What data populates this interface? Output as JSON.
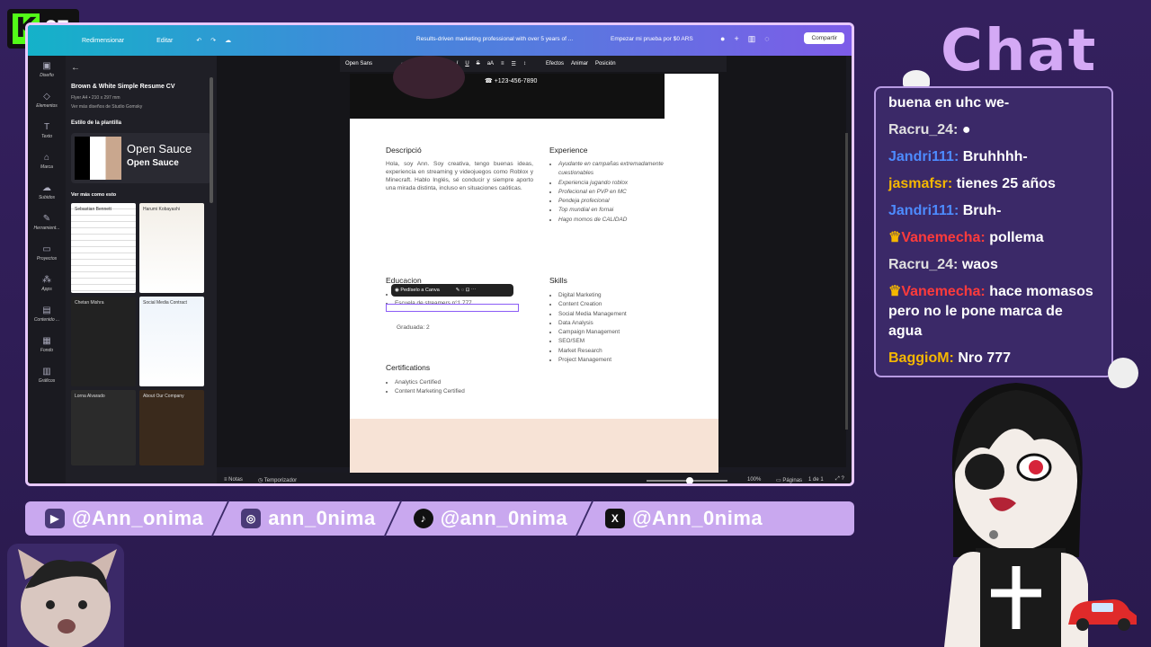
{
  "kick": {
    "logo": "K",
    "viewers": "27"
  },
  "canva": {
    "topbar": {
      "resize": "Redimensionar",
      "edit": "Editar",
      "title": "Results-driven marketing professional with over 5 years of ...",
      "trial": "Empezar mi prueba por $0 ARS",
      "share": "Compartir"
    },
    "rail": [
      "Diseño",
      "Elementos",
      "Texto",
      "Marca",
      "Subidos",
      "Herramient...",
      "Proyectos",
      "Apps",
      "Contenido ...",
      "Fondo",
      "Gráficos"
    ],
    "panel": {
      "template_title": "Brown & White Simple Resume CV",
      "size": "Flyer A4 • 210 x 297 mm",
      "more": "Ver más diseños de Studio Gomsky",
      "style_heading": "Estilo de la plantilla",
      "font_name": "Open Sauce",
      "font_name_bold": "Open Sauce",
      "see_more": "Ver más como esto",
      "thumb1": "Sebastian Bennett",
      "thumb2": "Harumi Kobayashi",
      "thumb3": "Chetan Mishra",
      "thumb4": "Social Media Contract",
      "thumb5": "Lorna Alvarado",
      "thumb6": "About Our Company"
    },
    "toolbar": {
      "font": "Open Sans",
      "size": "11",
      "effects": "Efectos",
      "animate": "Animar",
      "position": "Posición"
    },
    "resume": {
      "phone": "+123-456-7890",
      "desc_h": "Descripció",
      "desc": "Hola, soy Ann. Soy creativa, tengo buenas ideas, experiencia en streaming y videojuegos como Roblox y Minecraft. Hablo Inglés, sé conducir y siempre aporto una mirada distinta, incluso en situaciones caóticas.",
      "exp_h": "Experience",
      "exp": [
        "Ayudante en campañas extremadamente cuestionables",
        "Experiencia jugando roblox",
        "Profecional en PVP en MC",
        "Pendeja profecional",
        "Top mundial en fornai",
        "Hago momos de CALIDAD"
      ],
      "edu_h": "Educacion",
      "edu": [
        "Técnica en sexso",
        "Escuela de streamers n°1 777"
      ],
      "grad": "Graduada: 2",
      "popup": "Pedíselo a Canva",
      "skills_h": "Skills",
      "skills": [
        "Digital Marketing",
        "Content Creation",
        "Social Media Management",
        "Data Analysis",
        "Campaign Management",
        "SEO/SEM",
        "Market Research",
        "Project Management"
      ],
      "cert_h": "Certifications",
      "certs": [
        "Analytics Certified",
        "Content Marketing Certified"
      ]
    },
    "bottom": {
      "notes": "Notas",
      "timer": "Temporizador",
      "zoom": "100%",
      "pages_label": "Páginas",
      "pages": "1 de 1"
    }
  },
  "chat": {
    "title": "Chat",
    "messages": [
      {
        "user": "",
        "text": "buena en uhc we-",
        "color": "#ffffff"
      },
      {
        "user": "Racru_24:",
        "text": "",
        "color": "#e0e0e0"
      },
      {
        "user": "Jandri111:",
        "text": "Bruhhhh-",
        "color": "#4d8bff"
      },
      {
        "user": "jasmafsr:",
        "text": "tienes 25 años",
        "color": "#f5b700"
      },
      {
        "user": "Jandri111:",
        "text": "Bruh-",
        "color": "#4d8bff"
      },
      {
        "user": "Vanemecha:",
        "text": "pollema",
        "color": "#ff3b3b"
      },
      {
        "user": "Racru_24:",
        "text": "waos",
        "color": "#e0e0e0"
      },
      {
        "user": "Vanemecha:",
        "text": "hace momasos pero no le pone marca de agua",
        "color": "#ff3b3b"
      },
      {
        "user": "BaggioM:",
        "text": "Nro 777",
        "color": "#f5b700"
      }
    ]
  },
  "socials": [
    {
      "icon": "youtube-icon",
      "handle": "@Ann_onima"
    },
    {
      "icon": "instagram-icon",
      "handle": "ann_0nima"
    },
    {
      "icon": "tiktok-icon",
      "handle": "@ann_0nima"
    },
    {
      "icon": "x-icon",
      "handle": "@Ann_0nima"
    }
  ]
}
